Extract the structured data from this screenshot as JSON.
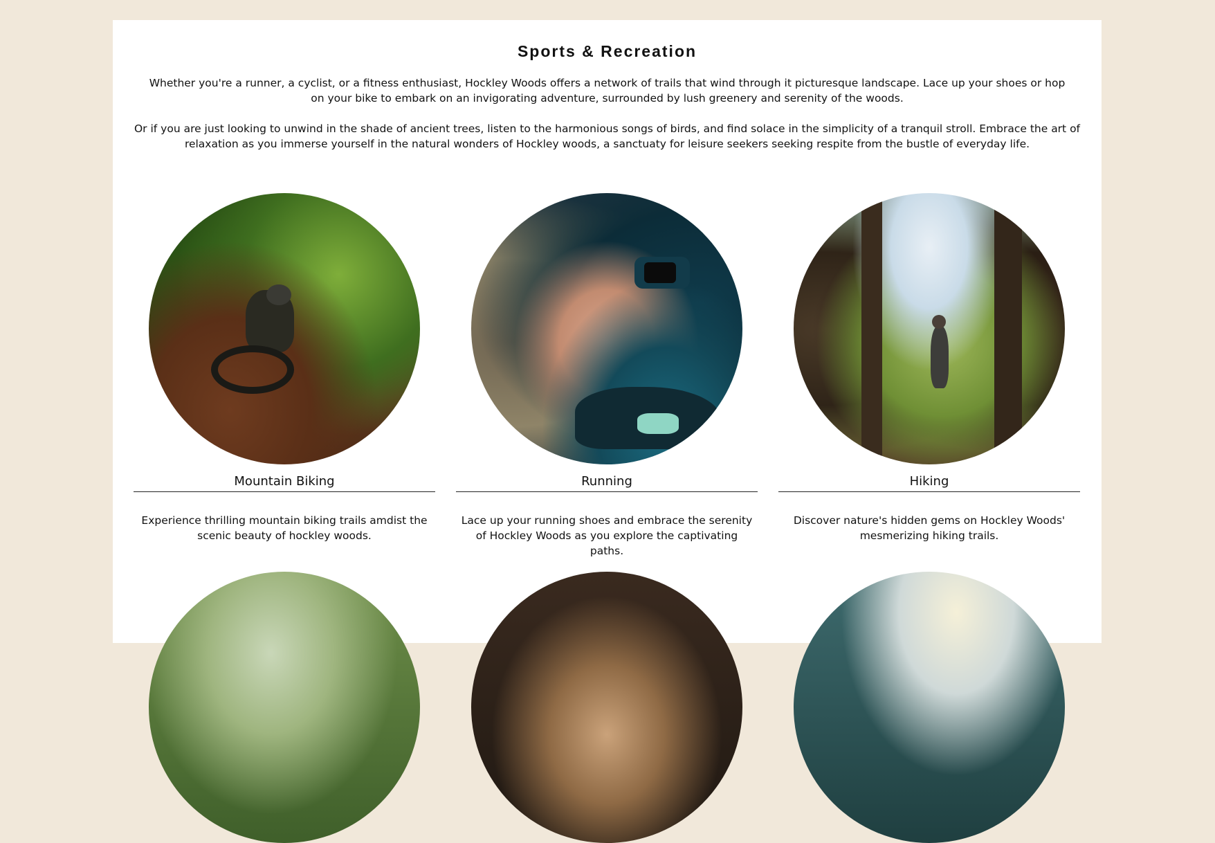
{
  "section": {
    "title": "Sports & Recreation",
    "intro_1": "Whether you're a runner, a cyclist, or a fitness enthusiast, Hockley Woods offers a network of trails that wind through it picturesque landscape. Lace up your shoes or hop on your bike to embark on an invigorating adventure, surrounded by lush greenery and serenity of the woods.",
    "intro_2": "Or if you are just looking to unwind in the shade of ancient trees, listen to the harmonious songs of birds, and find solace in the simplicity of a tranquil stroll. Embrace the art of relaxation as you immerse yourself in the natural wonders of Hockley woods, a sanctuaty for leisure seekers seeking respite from the bustle of everyday life."
  },
  "activities": [
    {
      "title": "Mountain Biking",
      "description": "Experience thrilling mountain biking trails amdist the scenic beauty of hockley woods.",
      "image": "mountain-biker-in-forest"
    },
    {
      "title": "Running",
      "description": "Lace up your running shoes and embrace the serenity of Hockley Woods as you explore the captivating paths.",
      "image": "runner-tying-shoe"
    },
    {
      "title": "Hiking",
      "description": "Discover nature's hidden gems on Hockley Woods' mesmerizing hiking trails.",
      "image": "hiker-on-forest-trail"
    }
  ],
  "colors": {
    "page_background": "#f1e8da",
    "panel_background": "#ffffff",
    "text": "#111111",
    "rule": "#222222"
  }
}
